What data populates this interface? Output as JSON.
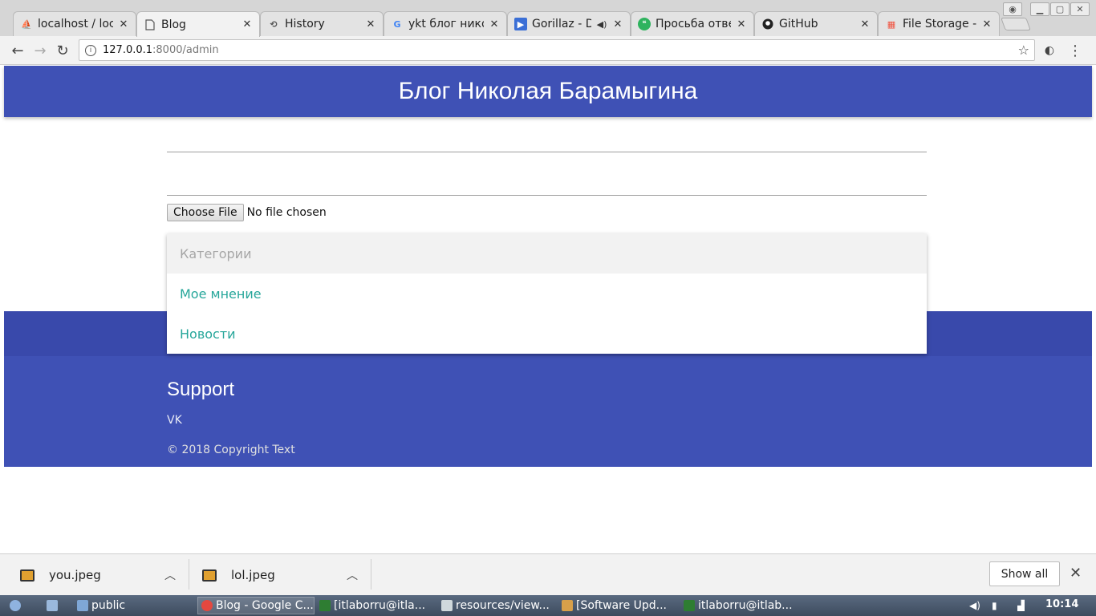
{
  "browser": {
    "tabs": [
      {
        "title": "localhost / loc",
        "icon": "phpmyadmin-icon",
        "active": false
      },
      {
        "title": "Blog",
        "icon": "page-icon",
        "active": true
      },
      {
        "title": "History",
        "icon": "history-icon",
        "active": false
      },
      {
        "title": "ykt блог нико",
        "icon": "google-icon",
        "active": false
      },
      {
        "title": "Gorillaz - Di",
        "icon": "play-icon",
        "active": false
      },
      {
        "title": "Просьба отве",
        "icon": "hangouts-icon",
        "active": false
      },
      {
        "title": "GitHub",
        "icon": "github-icon",
        "active": false
      },
      {
        "title": "File Storage -",
        "icon": "laravel-icon",
        "active": false
      }
    ],
    "url_host": "127.0.0.1",
    "url_path": ":8000/admin"
  },
  "site": {
    "title": "Блог Николая Барамыгина"
  },
  "form": {
    "file_button": "Choose File",
    "file_status": "No file chosen"
  },
  "dropdown": {
    "items": [
      {
        "label": "Категории",
        "disabled": true
      },
      {
        "label": "Мое мнение",
        "disabled": false
      },
      {
        "label": "Новости",
        "disabled": false
      }
    ]
  },
  "footer": {
    "heading": "Support",
    "link": "VK",
    "copyright": "© 2018 Copyright Text"
  },
  "downloads": {
    "files": [
      "you.jpeg",
      "lol.jpeg"
    ],
    "show_all": "Show all"
  },
  "taskbar": {
    "items": [
      "public",
      "Blog - Google C...",
      "[itlaborru@itla...",
      "resources/view...",
      "[Software Upd...",
      "itlaborru@itlab..."
    ],
    "clock": "10:14"
  },
  "colors": {
    "primary": "#3f51b5",
    "accent_link": "#26a69a"
  }
}
